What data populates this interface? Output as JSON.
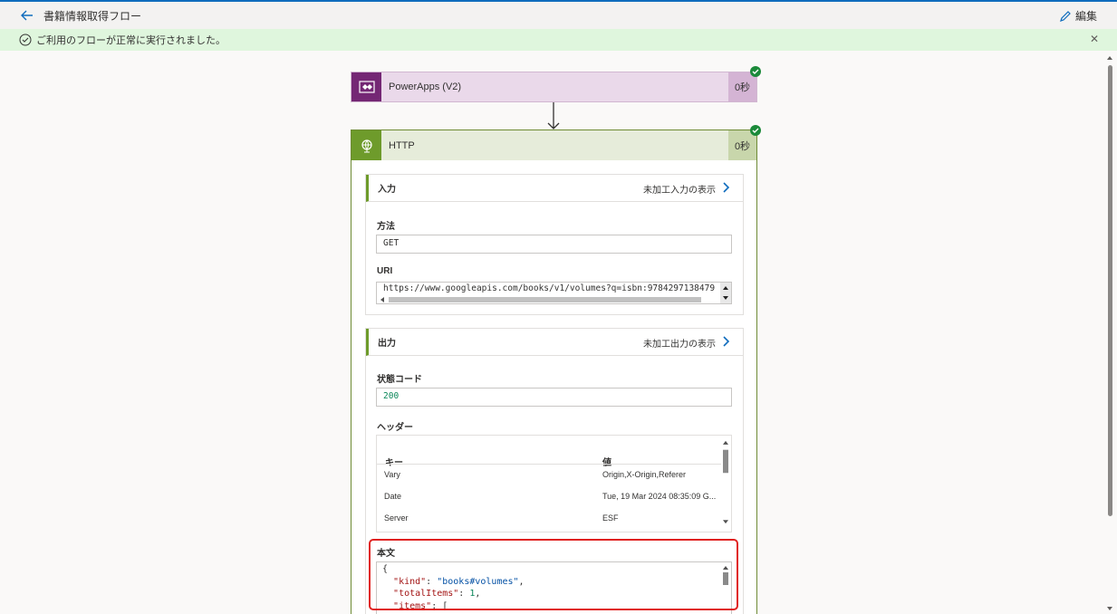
{
  "command_bar": {
    "title": "書籍情報取得フロー",
    "edit_label": "編集"
  },
  "banner": {
    "message": "ご利用のフローが正常に実行されました。"
  },
  "trigger_card": {
    "title": "PowerApps (V2)",
    "duration": "0秒",
    "accent_color": "#742774"
  },
  "http_card": {
    "title": "HTTP",
    "duration": "0秒",
    "accent_color": "#6e9b2b",
    "inputs": {
      "heading": "入力",
      "raw_link": "未加工入力の表示",
      "method_label": "方法",
      "method_value": "GET",
      "uri_label": "URI",
      "uri_value": "https://www.googleapis.com/books/v1/volumes?q=isbn:9784297138479"
    },
    "outputs": {
      "heading": "出力",
      "raw_link": "未加工出力の表示",
      "status_label": "状態コード",
      "status_value": "200",
      "headers_label": "ヘッダー",
      "headers_columns": [
        "キー",
        "値"
      ],
      "headers_rows": [
        {
          "key": "Vary",
          "value": "Origin,X-Origin,Referer"
        },
        {
          "key": "Date",
          "value": "Tue, 19 Mar 2024 08:35:09 G..."
        },
        {
          "key": "Server",
          "value": "ESF"
        }
      ],
      "body_label": "本文",
      "body_lines": {
        "l1": "{",
        "k1": "\"kind\"",
        "v1": "\"books#volumes\"",
        "k2": "\"totalItems\"",
        "v2": "1",
        "k3": "\"items\"",
        "v3": "["
      }
    }
  },
  "colors": {
    "success_banner": "#dff6dd",
    "success_check": "#1b8a3a",
    "highlight": "#e0211f"
  }
}
